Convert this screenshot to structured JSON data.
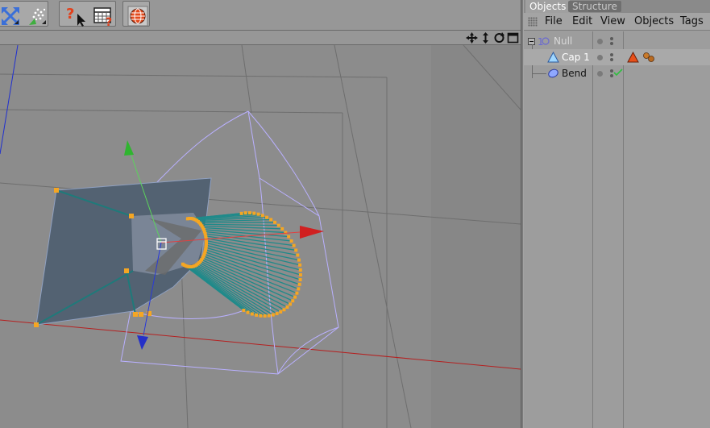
{
  "panel": {
    "tabs": [
      "Objects",
      "Structure"
    ],
    "menu": [
      "File",
      "Edit",
      "View",
      "Objects",
      "Tags"
    ]
  },
  "objects": [
    {
      "name": "Null",
      "icon": "null-object-icon",
      "level": 0
    },
    {
      "name": "Cap 1",
      "icon": "cap-object-icon",
      "level": 1,
      "tags": [
        "phong-tag-icon",
        "material-tag-icon"
      ]
    },
    {
      "name": "Bend",
      "icon": "bend-deformer-icon",
      "level": 1,
      "enabled": true
    }
  ],
  "toolbar": {
    "buttons": [
      "maximize-arrows-icon",
      "particles-icon",
      "help-cursor-icon",
      "calendar-help-icon",
      "render-globe-icon"
    ]
  },
  "viewport": {
    "nav_icons": [
      "move-view-icon",
      "zoom-view-icon",
      "rotate-view-icon",
      "maximize-view-icon"
    ]
  },
  "colors": {
    "x_axis": "#cc2222",
    "y_axis": "#22aa22",
    "z_axis": "#2233cc",
    "points": "#f5a623",
    "cage": "#b8b0ff"
  }
}
